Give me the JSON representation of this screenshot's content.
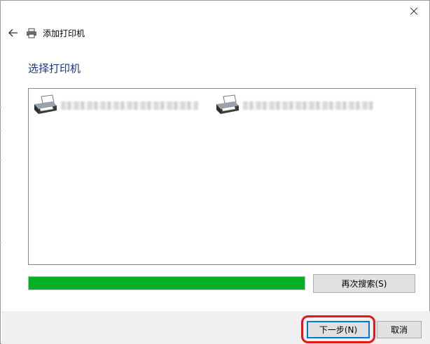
{
  "window": {
    "title": "添加打印机",
    "close_icon": "close-icon",
    "back_icon": "back-arrow-icon",
    "printer_icon": "printer-icon"
  },
  "page": {
    "heading": "选择打印机"
  },
  "printers": [
    {
      "name": "",
      "icon": "printer-icon",
      "name_obscured": true
    },
    {
      "name": "",
      "icon": "printer-icon",
      "name_obscured": true
    }
  ],
  "search": {
    "progress_fraction": 1.0,
    "progress_color": "#06b025",
    "research_button": "再次搜索(S)"
  },
  "footer": {
    "next_button": "下一步(N)",
    "cancel_button": "取消",
    "highlight_color": "#e8141b"
  }
}
